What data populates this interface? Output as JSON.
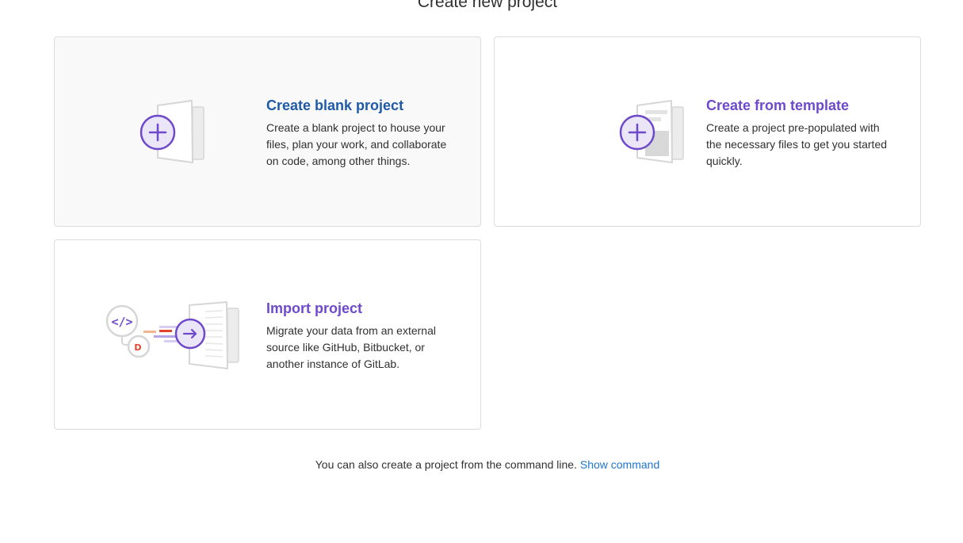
{
  "page": {
    "title": "Create new project"
  },
  "cards": [
    {
      "title": "Create blank project",
      "description": "Create a blank project to house your files, plan your work, and collaborate on code, among other things."
    },
    {
      "title": "Create from template",
      "description": "Create a project pre-populated with the necessary files to get you started quickly."
    },
    {
      "title": "Import project",
      "description": "Migrate your data from an external source like GitHub, Bitbucket, or another instance of GitLab."
    }
  ],
  "footer": {
    "text": "You can also create a project from the command line.",
    "link_label": "Show command"
  },
  "icons": {
    "blank": "plus-document-icon",
    "template": "template-document-icon",
    "import": "import-code-arrow-icon"
  },
  "colors": {
    "accent_purple": "#6e49cb",
    "title_blue": "#1f5aa6",
    "link_blue": "#1f75cb",
    "card_border": "#dcdcde",
    "hover_bg": "#f9f9f9",
    "orange": "#e2432a"
  }
}
